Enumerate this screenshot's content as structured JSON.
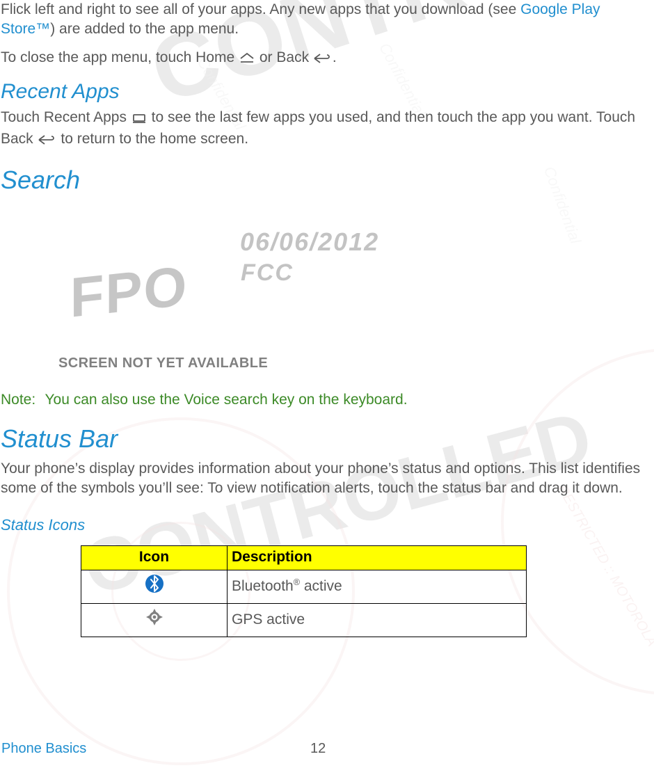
{
  "watermark": {
    "date": "06/06/2012",
    "fcc": "FCC",
    "controlled": "CONTROLLED",
    "confidential": "Confidential",
    "restricted_arc": "RESTRICTED :: MOTOROLA",
    "fpo": "FPO",
    "screen_unavailable": "SCREEN NOT YET AVAILABLE"
  },
  "intro": {
    "part1": "Flick left and right to see all of your apps. Any new apps that you download (see ",
    "link": "Google Play Store™",
    "part2": ") are added to the app menu.",
    "close_line_a": "To close the app menu, touch Home ",
    "close_line_b": " or Back ",
    "period": "."
  },
  "recent": {
    "heading": "Recent Apps",
    "line1a": "Touch Recent Apps ",
    "line1b": " to see the last few apps you used, and then touch the app you want. Touch Back ",
    "line1c": " to return to the home screen."
  },
  "search": {
    "heading": "Search",
    "note_label": "Note:",
    "note_body": "You can also use the Voice search key on the keyboard."
  },
  "status_bar": {
    "heading": "Status Bar",
    "para": "Your phone’s display provides information about your phone’s status and options. This list identifies some of the symbols you’ll see: To view notification alerts, touch the status bar and drag it down.",
    "sub_heading": "Status Icons",
    "table": {
      "col_icon": "Icon",
      "col_desc": "Description",
      "rows": [
        {
          "icon_name": "bluetooth-icon",
          "desc_pre": "Bluetooth",
          "desc_sup": "®",
          "desc_post": " active"
        },
        {
          "icon_name": "gps-icon",
          "desc_pre": "GPS active",
          "desc_sup": "",
          "desc_post": ""
        }
      ]
    }
  },
  "footer": {
    "section": "Phone Basics",
    "page": "12"
  }
}
